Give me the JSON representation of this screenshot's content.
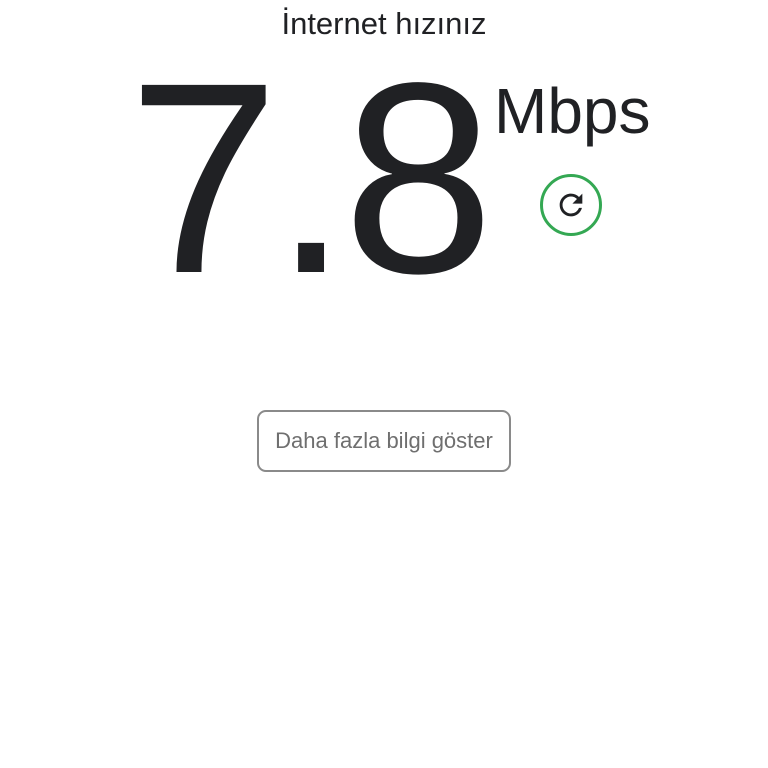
{
  "header": {
    "title": "İnternet hızınız"
  },
  "speed": {
    "value": "7.8",
    "unit": "Mbps"
  },
  "refresh": {
    "icon": "refresh-icon",
    "border_color": "#34a853"
  },
  "more_info": {
    "label": "Daha fazla bilgi göster"
  }
}
